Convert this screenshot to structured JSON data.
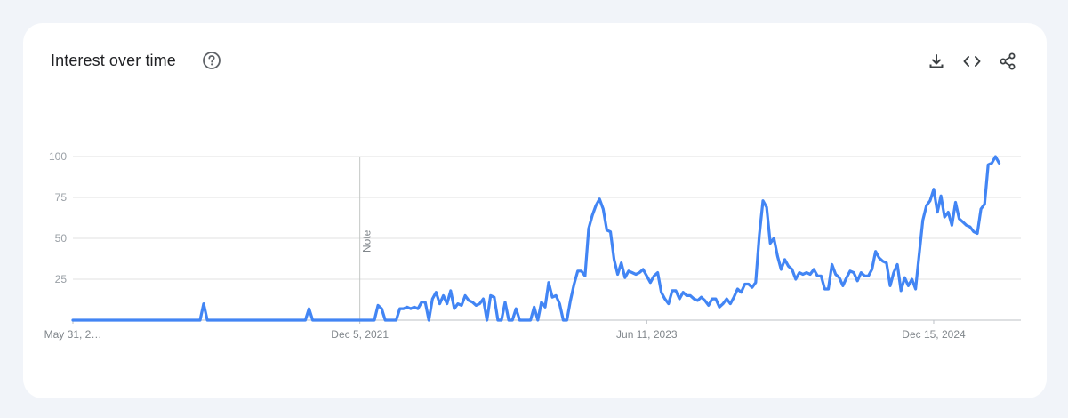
{
  "card": {
    "title": "Interest over time",
    "help_icon": "help-circle-icon",
    "tools": [
      {
        "name": "download-icon"
      },
      {
        "name": "embed-code-icon"
      },
      {
        "name": "share-icon"
      }
    ]
  },
  "chart_data": {
    "type": "line",
    "title": "",
    "xlabel": "",
    "ylabel": "",
    "ylim": [
      0,
      100
    ],
    "yticks": [
      25,
      50,
      75,
      100
    ],
    "x_range": [
      "2020-05-31",
      "2025-06-01"
    ],
    "xtick_labels": [
      "May 31, 2…",
      "Dec 5, 2021",
      "Jun 11, 2023",
      "Dec 15, 2024"
    ],
    "xticks": [
      "2020-05-31",
      "2021-12-05",
      "2023-06-11",
      "2024-12-15"
    ],
    "annotations": [
      {
        "x": "2021-12-05",
        "text": "Note"
      }
    ],
    "grid": true,
    "color": "#4285f4",
    "series": [
      {
        "points": [
          [
            "2020-05-31",
            0
          ],
          [
            "2021-01-31",
            0
          ],
          [
            "2021-02-07",
            10
          ],
          [
            "2021-02-14",
            0
          ],
          [
            "2021-08-22",
            0
          ],
          [
            "2021-08-29",
            7
          ],
          [
            "2021-09-05",
            0
          ],
          [
            "2021-12-05",
            0
          ],
          [
            "2022-01-02",
            0
          ],
          [
            "2022-01-09",
            9
          ],
          [
            "2022-01-16",
            7
          ],
          [
            "2022-01-23",
            0
          ],
          [
            "2022-02-13",
            0
          ],
          [
            "2022-02-20",
            7
          ],
          [
            "2022-02-27",
            7
          ],
          [
            "2022-03-06",
            8
          ],
          [
            "2022-03-13",
            7
          ],
          [
            "2022-03-20",
            8
          ],
          [
            "2022-03-27",
            7
          ],
          [
            "2022-04-03",
            11
          ],
          [
            "2022-04-10",
            11
          ],
          [
            "2022-04-17",
            0
          ],
          [
            "2022-04-24",
            13
          ],
          [
            "2022-05-01",
            17
          ],
          [
            "2022-05-08",
            10
          ],
          [
            "2022-05-15",
            15
          ],
          [
            "2022-05-22",
            10
          ],
          [
            "2022-05-29",
            18
          ],
          [
            "2022-06-05",
            7
          ],
          [
            "2022-06-12",
            10
          ],
          [
            "2022-06-19",
            9
          ],
          [
            "2022-06-26",
            15
          ],
          [
            "2022-07-03",
            12
          ],
          [
            "2022-07-10",
            11
          ],
          [
            "2022-07-17",
            9
          ],
          [
            "2022-07-24",
            10
          ],
          [
            "2022-07-31",
            13
          ],
          [
            "2022-08-07",
            0
          ],
          [
            "2022-08-14",
            15
          ],
          [
            "2022-08-21",
            14
          ],
          [
            "2022-08-28",
            0
          ],
          [
            "2022-09-04",
            0
          ],
          [
            "2022-09-11",
            11
          ],
          [
            "2022-09-18",
            0
          ],
          [
            "2022-09-25",
            0
          ],
          [
            "2022-10-02",
            7
          ],
          [
            "2022-10-09",
            0
          ],
          [
            "2022-10-30",
            0
          ],
          [
            "2022-11-06",
            8
          ],
          [
            "2022-11-13",
            0
          ],
          [
            "2022-11-20",
            11
          ],
          [
            "2022-11-27",
            8
          ],
          [
            "2022-12-04",
            23
          ],
          [
            "2022-12-11",
            14
          ],
          [
            "2022-12-18",
            15
          ],
          [
            "2022-12-25",
            10
          ],
          [
            "2023-01-01",
            0
          ],
          [
            "2023-01-08",
            0
          ],
          [
            "2023-01-15",
            12
          ],
          [
            "2023-01-22",
            22
          ],
          [
            "2023-01-29",
            30
          ],
          [
            "2023-02-05",
            30
          ],
          [
            "2023-02-12",
            27
          ],
          [
            "2023-02-19",
            56
          ],
          [
            "2023-02-26",
            64
          ],
          [
            "2023-03-05",
            70
          ],
          [
            "2023-03-12",
            74
          ],
          [
            "2023-03-19",
            68
          ],
          [
            "2023-03-26",
            55
          ],
          [
            "2023-04-02",
            54
          ],
          [
            "2023-04-09",
            37
          ],
          [
            "2023-04-16",
            28
          ],
          [
            "2023-04-23",
            35
          ],
          [
            "2023-04-30",
            26
          ],
          [
            "2023-05-07",
            30
          ],
          [
            "2023-05-14",
            29
          ],
          [
            "2023-05-21",
            28
          ],
          [
            "2023-05-28",
            29
          ],
          [
            "2023-06-04",
            31
          ],
          [
            "2023-06-11",
            27
          ],
          [
            "2023-06-18",
            23
          ],
          [
            "2023-06-25",
            27
          ],
          [
            "2023-07-02",
            29
          ],
          [
            "2023-07-09",
            17
          ],
          [
            "2023-07-16",
            13
          ],
          [
            "2023-07-23",
            10
          ],
          [
            "2023-07-30",
            18
          ],
          [
            "2023-08-06",
            18
          ],
          [
            "2023-08-13",
            13
          ],
          [
            "2023-08-20",
            17
          ],
          [
            "2023-08-27",
            15
          ],
          [
            "2023-09-03",
            15
          ],
          [
            "2023-09-10",
            13
          ],
          [
            "2023-09-17",
            12
          ],
          [
            "2023-09-24",
            14
          ],
          [
            "2023-10-01",
            12
          ],
          [
            "2023-10-08",
            9
          ],
          [
            "2023-10-15",
            13
          ],
          [
            "2023-10-22",
            13
          ],
          [
            "2023-10-29",
            8
          ],
          [
            "2023-11-05",
            10
          ],
          [
            "2023-11-12",
            13
          ],
          [
            "2023-11-19",
            10
          ],
          [
            "2023-11-26",
            14
          ],
          [
            "2023-12-03",
            19
          ],
          [
            "2023-12-10",
            17
          ],
          [
            "2023-12-17",
            22
          ],
          [
            "2023-12-24",
            22
          ],
          [
            "2023-12-31",
            20
          ],
          [
            "2024-01-07",
            23
          ],
          [
            "2024-01-14",
            52
          ],
          [
            "2024-01-21",
            73
          ],
          [
            "2024-01-28",
            69
          ],
          [
            "2024-02-04",
            47
          ],
          [
            "2024-02-11",
            50
          ],
          [
            "2024-02-18",
            39
          ],
          [
            "2024-02-25",
            31
          ],
          [
            "2024-03-03",
            37
          ],
          [
            "2024-03-10",
            33
          ],
          [
            "2024-03-17",
            31
          ],
          [
            "2024-03-24",
            25
          ],
          [
            "2024-03-31",
            29
          ],
          [
            "2024-04-07",
            28
          ],
          [
            "2024-04-14",
            29
          ],
          [
            "2024-04-21",
            28
          ],
          [
            "2024-04-28",
            31
          ],
          [
            "2024-05-05",
            27
          ],
          [
            "2024-05-12",
            27
          ],
          [
            "2024-05-19",
            19
          ],
          [
            "2024-05-26",
            19
          ],
          [
            "2024-06-02",
            34
          ],
          [
            "2024-06-09",
            28
          ],
          [
            "2024-06-16",
            26
          ],
          [
            "2024-06-23",
            21
          ],
          [
            "2024-06-30",
            26
          ],
          [
            "2024-07-07",
            30
          ],
          [
            "2024-07-14",
            29
          ],
          [
            "2024-07-21",
            24
          ],
          [
            "2024-07-28",
            29
          ],
          [
            "2024-08-04",
            27
          ],
          [
            "2024-08-11",
            27
          ],
          [
            "2024-08-18",
            31
          ],
          [
            "2024-08-25",
            42
          ],
          [
            "2024-09-01",
            38
          ],
          [
            "2024-09-08",
            36
          ],
          [
            "2024-09-15",
            35
          ],
          [
            "2024-09-22",
            21
          ],
          [
            "2024-09-29",
            29
          ],
          [
            "2024-10-06",
            34
          ],
          [
            "2024-10-13",
            18
          ],
          [
            "2024-10-20",
            26
          ],
          [
            "2024-10-27",
            21
          ],
          [
            "2024-11-03",
            25
          ],
          [
            "2024-11-10",
            19
          ],
          [
            "2024-11-17",
            40
          ],
          [
            "2024-11-24",
            61
          ],
          [
            "2024-12-01",
            70
          ],
          [
            "2024-12-08",
            73
          ],
          [
            "2024-12-15",
            80
          ],
          [
            "2024-12-22",
            66
          ],
          [
            "2024-12-29",
            76
          ],
          [
            "2025-01-05",
            63
          ],
          [
            "2025-01-12",
            66
          ],
          [
            "2025-01-19",
            58
          ],
          [
            "2025-01-26",
            72
          ],
          [
            "2025-02-02",
            62
          ],
          [
            "2025-02-09",
            60
          ],
          [
            "2025-02-16",
            58
          ],
          [
            "2025-02-23",
            57
          ],
          [
            "2025-03-02",
            54
          ],
          [
            "2025-03-09",
            53
          ],
          [
            "2025-03-16",
            68
          ],
          [
            "2025-03-23",
            71
          ],
          [
            "2025-03-30",
            95
          ],
          [
            "2025-04-06",
            96
          ],
          [
            "2025-04-13",
            100
          ],
          [
            "2025-04-20",
            96
          ]
        ]
      }
    ]
  }
}
